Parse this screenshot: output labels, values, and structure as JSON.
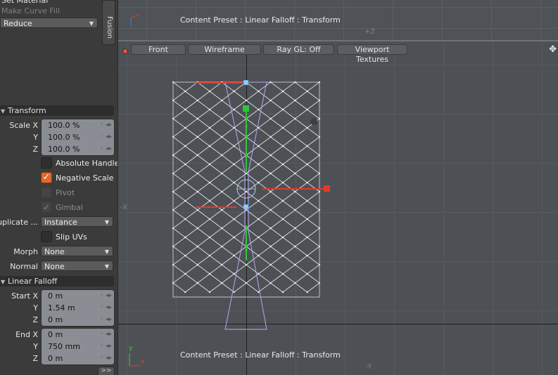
{
  "left_panel": {
    "top_items": [
      "Set Material",
      "Make Curve Fill"
    ],
    "reduce_dropdown": "Reduce",
    "fusion_tab": "Fusion",
    "transform": {
      "header": "Transform",
      "scale_labels": [
        "Scale X",
        "Y",
        "Z"
      ],
      "scale_values": [
        "100.0 %",
        "100.0 %",
        "100.0 %"
      ],
      "absolute_handle": "Absolute Handle",
      "negative_scale": "Negative Scale",
      "pivot": "Pivot",
      "gimbal": "Gimbal",
      "duplicate_label": "Duplicate ...",
      "duplicate_value": "Instance",
      "slip_uvs": "Slip UVs",
      "morph_label": "Morph",
      "morph_value": "None",
      "normal_label": "Normal",
      "normal_value": "None"
    },
    "linear_falloff": {
      "header": "Linear Falloff",
      "start_labels": [
        "Start X",
        "Y",
        "Z"
      ],
      "start_values": [
        "0 m",
        "1.54 m",
        "0 m"
      ],
      "end_labels": [
        "End X",
        "Y",
        "Z"
      ],
      "end_values": [
        "0 m",
        "750 mm",
        "0 m"
      ]
    },
    "more_button": ">>"
  },
  "top_viewport": {
    "caption": "Content Preset : Linear Falloff : Transform",
    "axis_bottom": "+Z"
  },
  "main_viewport": {
    "buttons": [
      "Front",
      "Wireframe",
      "Ray GL: Off",
      "Viewport Textures"
    ],
    "axis_left": "-X",
    "axis_bottom": "-Y",
    "caption": "Content Preset : Linear Falloff : Transform",
    "axis_gizmo_x": "X",
    "axis_gizmo_y": "Y"
  },
  "icons": {
    "dropdown_caret": "▼",
    "section_triangle": "▼",
    "checkmark": "✓",
    "field_icons": "◦ ◂▸",
    "move_icon": "✥"
  },
  "colors": {
    "accent_orange": "#e06a2a",
    "handle_red": "#e03a2a",
    "handle_green": "#2ec63a",
    "handle_blue": "#8ad0ff"
  }
}
